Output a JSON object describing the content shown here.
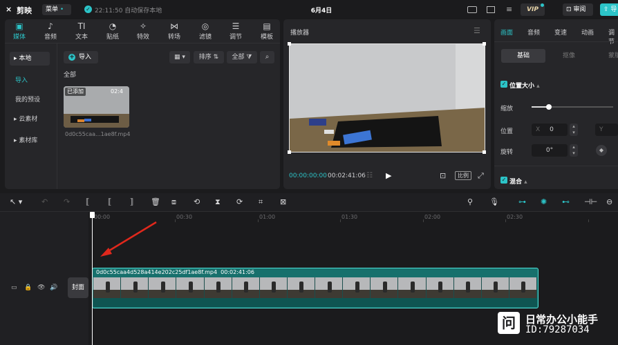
{
  "topbar": {
    "app_name": "剪映",
    "menu_label": "菜单",
    "menu_dot": "•",
    "save_status": "22:11:50 自动保存本地",
    "project_title": "6月4日",
    "vip_label": "VIP",
    "review_label": "审阅",
    "export_label": "导"
  },
  "tool_tabs": [
    {
      "label": "媒体",
      "icon": "media-icon",
      "glyph": "▣"
    },
    {
      "label": "音频",
      "icon": "audio-icon",
      "glyph": "♪"
    },
    {
      "label": "文本",
      "icon": "text-icon",
      "glyph": "TI"
    },
    {
      "label": "贴纸",
      "icon": "sticker-icon",
      "glyph": "◔"
    },
    {
      "label": "特效",
      "icon": "effects-icon",
      "glyph": "✧"
    },
    {
      "label": "转场",
      "icon": "transition-icon",
      "glyph": "⋈"
    },
    {
      "label": "滤镜",
      "icon": "filter-icon",
      "glyph": "◎"
    },
    {
      "label": "调节",
      "icon": "adjust-icon",
      "glyph": "☰"
    },
    {
      "label": "模板",
      "icon": "template-icon",
      "glyph": "▤"
    }
  ],
  "media_sidebar": {
    "local": "▸ 本地",
    "import": "导入",
    "presets": "我的预设",
    "cloud": "▸ 云素材",
    "library": "▸ 素材库"
  },
  "media_toolbar": {
    "import_label": "导入",
    "view_label": "▦ ▾",
    "sort_label": "排序 ⇅",
    "all_label": "全部 ⧩",
    "search_icon": "⌕"
  },
  "media_section": "全部",
  "media_item": {
    "badge": "已添加",
    "duration": "02:4",
    "filename": "0d0c55caa...1ae8f.mp4"
  },
  "player": {
    "title": "播放器",
    "menu_glyph": "☰",
    "current_time": "00:00:00:00",
    "total_time": "00:02:41:06",
    "ratio_label": "比例"
  },
  "props": {
    "tabs": [
      "画面",
      "音频",
      "变速",
      "动画",
      "调节"
    ],
    "segments": [
      "基础",
      "抠像",
      "蒙版"
    ],
    "position_size": "位置大小",
    "scale_label": "缩放",
    "position_label": "位置",
    "x_axis": "X",
    "x_value": "0",
    "y_axis": "Y",
    "rotation_label": "旋转",
    "rotation_value": "0°",
    "blend_label": "混合"
  },
  "timeline": {
    "ruler": [
      "00:00",
      "00:30",
      "01:00",
      "01:30",
      "02:00",
      "02:30"
    ],
    "cover_label": "封面",
    "clip_name": "0d0c55caa4d528a414e202c25df1ae8f.mp4",
    "clip_duration": "00:02:41:06"
  },
  "watermark": {
    "logo_char": "问",
    "name": "日常办公小能手",
    "id": "ID:79287034"
  },
  "colors": {
    "accent": "#2cc4c8",
    "arrow": "#e0281c"
  }
}
